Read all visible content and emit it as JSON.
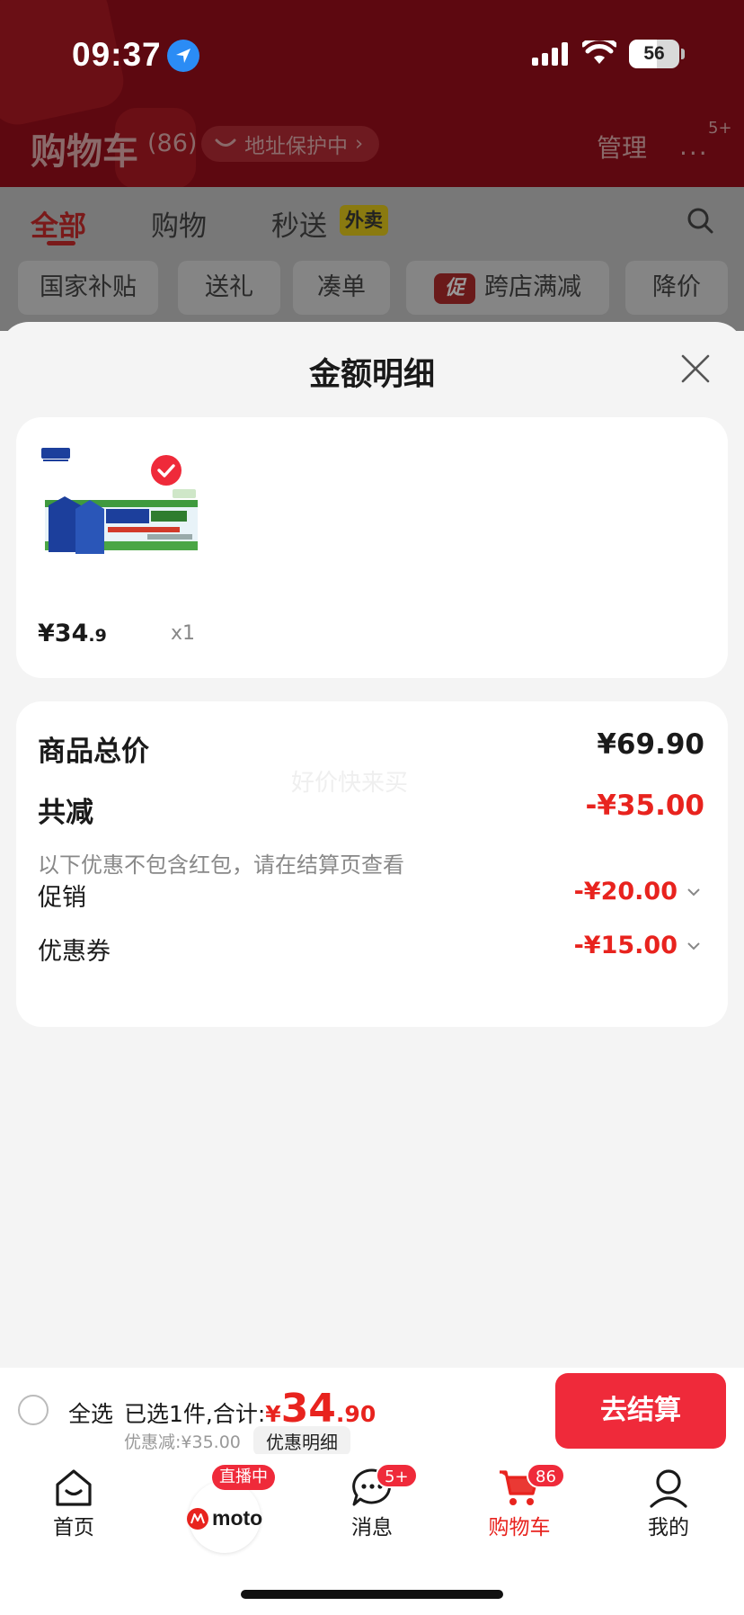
{
  "status_bar": {
    "time": "09:37",
    "battery": "56",
    "battery_level": 0.56
  },
  "background": {
    "title": "购物车",
    "count": "(86)",
    "address_pill": "地址保护中",
    "manage": "管理",
    "more_badge": "5+",
    "tabs": [
      "全部",
      "购物",
      "秒送"
    ],
    "waimai_tag": "外卖",
    "filters": [
      "国家补贴",
      "送礼",
      "凑单",
      "跨店满减",
      "降价"
    ],
    "cu_tag": "促"
  },
  "sheet": {
    "title": "金额明细",
    "product": {
      "price_int": "¥34",
      "price_dec": ".9",
      "qty": "x1"
    },
    "breakdown": {
      "total_label": "商品总价",
      "total_value": "¥69.90",
      "reduce_label": "共减",
      "reduce_value": "-¥35.00",
      "note": "以下优惠不包含红包，请在结算页查看",
      "promo_label": "促销",
      "promo_value": "-¥20.00",
      "coupon_label": "优惠券",
      "coupon_value": "-¥15.00",
      "watermark": "好价快来买"
    }
  },
  "checkout": {
    "select_all": "全选",
    "selected_text": "已选1件,合计:",
    "total_yen": "¥",
    "total_int": "34",
    "total_dec": ".90",
    "discount_text": "优惠减:¥35.00",
    "detail_pill": "优惠明细",
    "button": "去结算"
  },
  "tabbar": {
    "home": "首页",
    "live_badge": "直播中",
    "moto": "moto",
    "messages": "消息",
    "messages_badge": "5+",
    "cart": "购物车",
    "cart_badge": "86",
    "mine": "我的"
  },
  "colors": {
    "accent": "#e8231e",
    "button": "#ef2a3a",
    "header_bg": "#5d0810"
  }
}
